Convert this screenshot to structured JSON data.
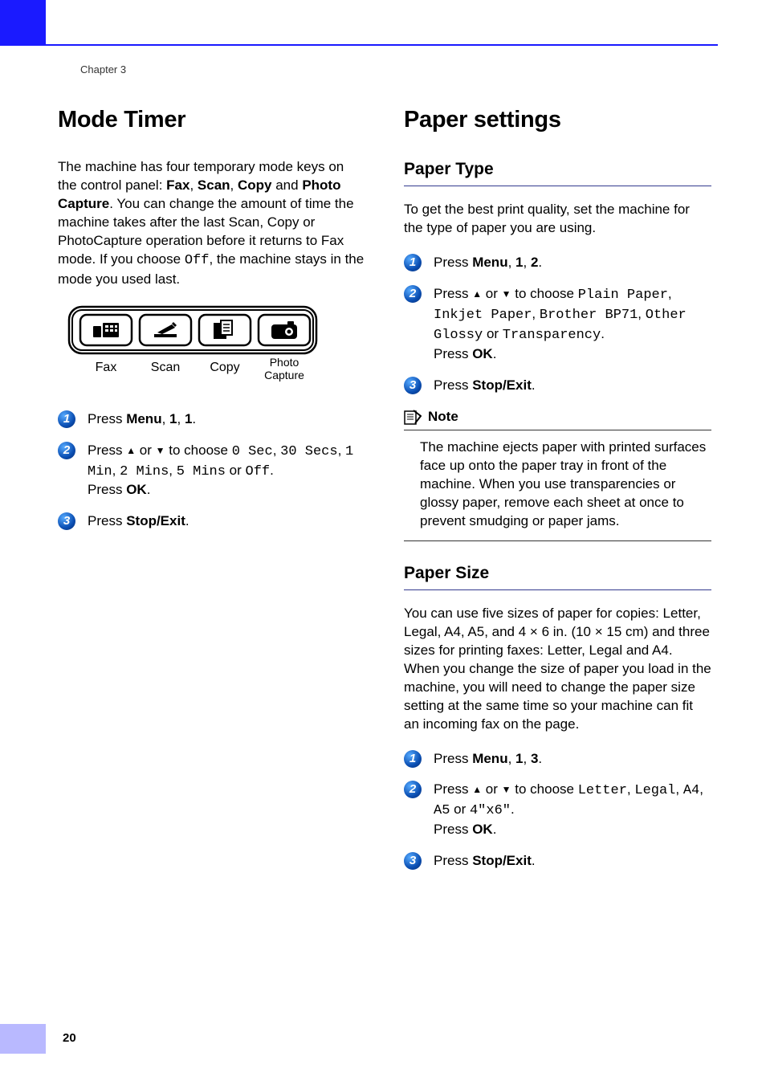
{
  "chapter": "Chapter 3",
  "page_number": "20",
  "left": {
    "heading": "Mode Timer",
    "intro_before_fax": "The machine has four temporary mode keys on the control panel: ",
    "k_fax": "Fax",
    "c1": ", ",
    "k_scan": "Scan",
    "c2": ", ",
    "k_copy": "Copy",
    "and": " and ",
    "k_photo": "Photo Capture",
    "intro_mid": ". You can change the amount of time the machine takes after the last Scan, Copy or PhotoCapture operation before it returns to Fax mode. If you choose ",
    "off1": "Off",
    "intro_after": ", the machine stays in the mode you used last.",
    "panel_labels": {
      "fax": "Fax",
      "scan": "Scan",
      "copy": "Copy",
      "photo1": "Photo",
      "photo2": "Capture"
    },
    "step1_a": "Press ",
    "step1_menu": "Menu",
    "step1_b": ", ",
    "step1_c": "1",
    "step1_d": ", ",
    "step1_e": "1",
    "step1_f": ".",
    "step2_a": "Press ",
    "step2_or": " or ",
    "step2_b": " to choose ",
    "opt0": "0 Sec",
    "comma": ", ",
    "opt30": "30 Secs",
    "opt1m": "1 Min",
    "opt2m": "2 Mins",
    "opt5m": "5 Mins",
    "or_sp": " or ",
    "optOff": "Off",
    "period": ".",
    "press": "Press ",
    "ok": "OK",
    "step3_a": "Press ",
    "stopexit": "Stop/Exit"
  },
  "right": {
    "heading": "Paper settings",
    "h2a": "Paper Type",
    "p1": "To get the best print quality, set the machine for the type of paper you are using.",
    "s1_a": "Press ",
    "s1_menu": "Menu",
    "s1_b": ", ",
    "s1_c": "1",
    "s1_d": ", ",
    "s1_e": "2",
    "s1_f": ".",
    "s2_a": "Press ",
    "s2_or": " or ",
    "s2_b": " to choose ",
    "optPlain": "Plain Paper",
    "c": ", ",
    "optInkjet": "Inkjet Paper",
    "optBP71": "Brother BP71",
    "optGlossy": "Other Glossy",
    "or_sp": " or ",
    "optTrans": "Transparency",
    "period": ".",
    "press": "Press ",
    "ok": "OK",
    "s3_a": "Press ",
    "stopexit": "Stop/Exit",
    "note_label": "Note",
    "note_body": "The machine ejects paper with printed surfaces face up onto the paper tray in front of the machine. When you use transparencies or glossy paper, remove each sheet at once to prevent smudging or paper jams.",
    "h2b": "Paper Size",
    "p2a": "You can use five sizes of paper for copies: Letter, Legal, A4, A5, and 4 ",
    "times": "×",
    "p2b": " 6 in. (10 ",
    "p2c": " 15 cm) and three sizes for printing faxes: Letter, Legal and A4. When you change the size of paper you load in the machine, you will need to change the paper size setting at the same time so your machine can fit an incoming fax on the page.",
    "t1_a": "Press ",
    "t1_menu": "Menu",
    "t1_b": ", ",
    "t1_c": "1",
    "t1_d": ", ",
    "t1_e": "3",
    "t1_f": ".",
    "t2_a": "Press ",
    "t2_or": " or ",
    "t2_b": " to choose ",
    "optLetter": "Letter",
    "optLegal": "Legal",
    "optA4": "A4",
    "optA5": "A5",
    "opt4x6": "4\"x6\"",
    "t3_a": "Press "
  }
}
